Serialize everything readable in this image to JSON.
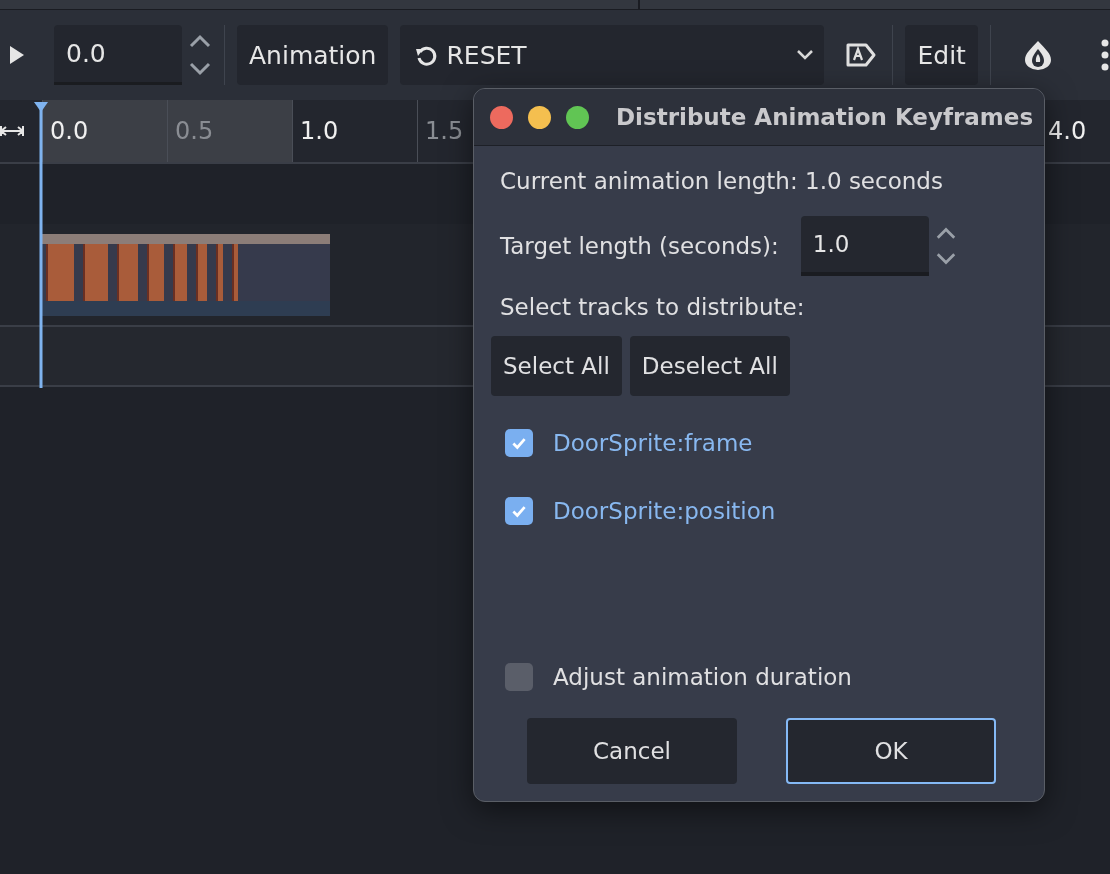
{
  "toolbar": {
    "time_value": "0.0",
    "animation_label": "Animation",
    "animation_select": "RESET",
    "edit_button": "Edit"
  },
  "timeline": {
    "ticks": [
      {
        "label": "0.0",
        "major": true,
        "in_range": true
      },
      {
        "label": "0.5",
        "major": false,
        "in_range": true
      },
      {
        "label": "1.0",
        "major": true,
        "in_range": false
      },
      {
        "label": "1.5",
        "major": false,
        "in_range": false
      }
    ],
    "end_tick": {
      "label": "4.0",
      "major": true,
      "in_range": false
    }
  },
  "dialog": {
    "title": "Distribute Animation Keyframes",
    "current_length": "Current animation length: 1.0 seconds",
    "target_label": "Target length (seconds):",
    "target_value": "1.0",
    "tracks_label": "Select tracks to distribute:",
    "select_all": "Select All",
    "deselect_all": "Deselect All",
    "tracks": [
      {
        "label": "DoorSprite:frame",
        "checked": true
      },
      {
        "label": "DoorSprite:position",
        "checked": true
      }
    ],
    "adjust": {
      "label": "Adjust animation duration",
      "checked": false
    },
    "buttons": [
      {
        "label": "Cancel",
        "focused": false
      },
      {
        "label": "OK",
        "focused": true
      }
    ]
  }
}
